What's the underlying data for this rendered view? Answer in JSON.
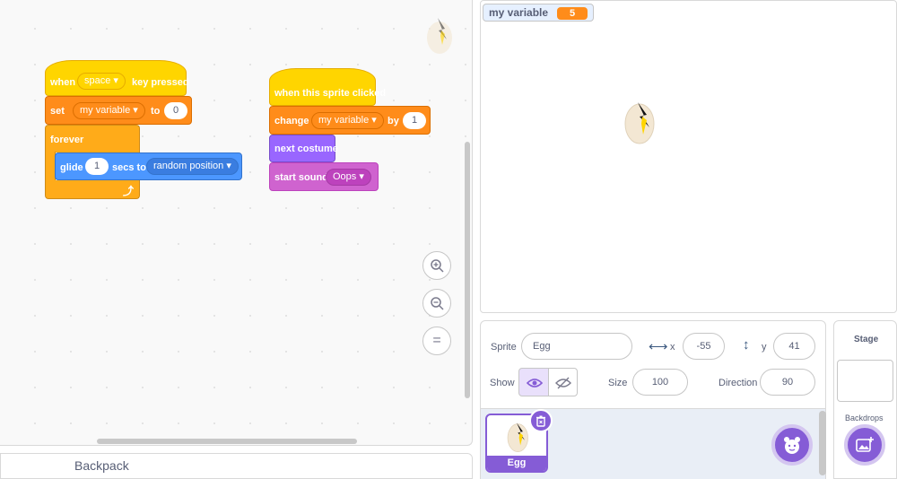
{
  "code": {
    "script1": {
      "hat_when": "when",
      "hat_key": "space",
      "hat_suffix": "key pressed",
      "set_label": "set",
      "set_var": "my variable",
      "set_to": "to",
      "set_value": "0",
      "forever_label": "forever",
      "glide_label": "glide",
      "glide_secs": "1",
      "glide_secs_to": "secs to",
      "glide_target": "random position"
    },
    "script2": {
      "hat_label": "when this sprite clicked",
      "change_label": "change",
      "change_var": "my variable",
      "change_by": "by",
      "change_value": "1",
      "next_costume": "next costume",
      "start_sound": "start sound",
      "sound_name": "Oops"
    },
    "zoom_in_icon": "zoom-in-icon",
    "zoom_out_icon": "zoom-out-icon",
    "zoom_reset": "="
  },
  "backpack": {
    "label": "Backpack"
  },
  "stage": {
    "monitor_label": "my variable",
    "monitor_value": "5"
  },
  "sprite_info": {
    "sprite_label": "Sprite",
    "sprite_name": "Egg",
    "x_label": "x",
    "x_value": "-55",
    "y_label": "y",
    "y_value": "41",
    "show_label": "Show",
    "size_label": "Size",
    "size_value": "100",
    "direction_label": "Direction",
    "direction_value": "90"
  },
  "sprite_list": [
    {
      "name": "Egg"
    }
  ],
  "stage_pane": {
    "title": "Stage",
    "backdrops_label": "Backdrops"
  },
  "colors": {
    "events": "#ffd500",
    "variables": "#ff8c1a",
    "control": "#ffab19",
    "motion": "#4c97ff",
    "looks": "#9966ff",
    "sound": "#cf63cf",
    "accent": "#855cd6"
  }
}
